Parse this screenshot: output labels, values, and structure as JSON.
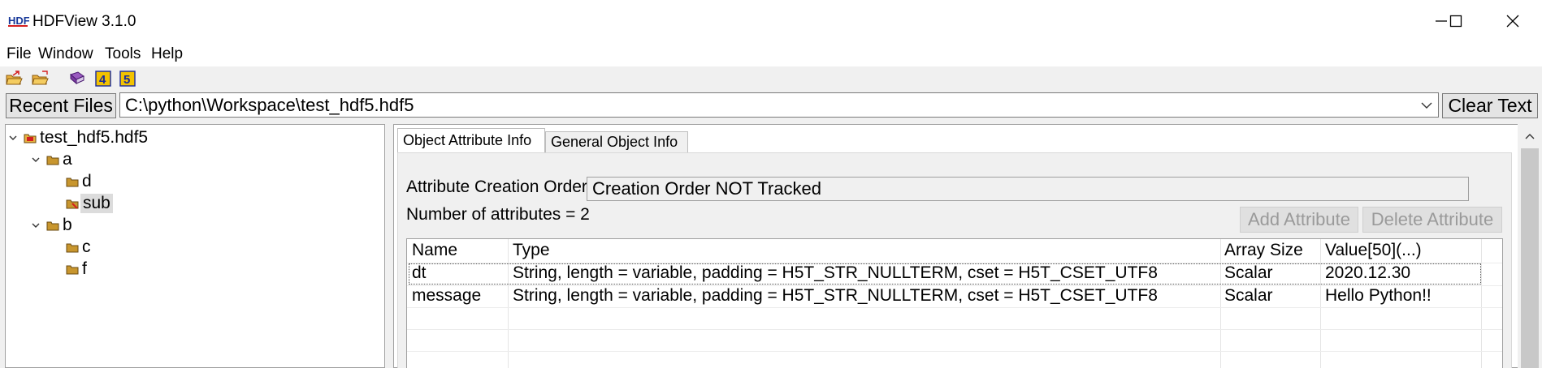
{
  "window": {
    "title": "HDFView 3.1.0",
    "logo_text": "HDF"
  },
  "menu": {
    "items": [
      {
        "label": "File"
      },
      {
        "label": "Window"
      },
      {
        "label": "Tools"
      },
      {
        "label": "Help"
      }
    ]
  },
  "toolbar": {
    "icons": [
      "open-folder-icon",
      "open-read-only-folder-icon",
      "user-guide-book-icon",
      "hdf4-library-icon",
      "hdf5-library-icon"
    ],
    "badge_4": "4",
    "badge_5": "5"
  },
  "path_bar": {
    "recent_files_label": "Recent Files",
    "current_path": "C:\\python\\Workspace\\test_hdf5.hdf5",
    "clear_text_label": "Clear Text"
  },
  "tree": {
    "root": {
      "label": "test_hdf5.hdf5",
      "expanded": true
    },
    "nodes": [
      {
        "label": "a",
        "expanded": true,
        "level": 1,
        "type": "group"
      },
      {
        "label": "d",
        "level": 2,
        "type": "group"
      },
      {
        "label": "sub",
        "level": 2,
        "type": "group",
        "selected": true
      },
      {
        "label": "b",
        "expanded": true,
        "level": 1,
        "type": "group"
      },
      {
        "label": "c",
        "level": 2,
        "type": "group"
      },
      {
        "label": "f",
        "level": 2,
        "type": "group"
      }
    ]
  },
  "tabs": [
    {
      "label": "Object Attribute Info",
      "active": true
    },
    {
      "label": "General Object Info",
      "active": false
    }
  ],
  "attribute_info": {
    "creation_order_label": "Attribute Creation Order:",
    "creation_order_value": "Creation Order NOT Tracked",
    "count_label": "Number of attributes = 2",
    "add_button": "Add Attribute",
    "delete_button": "Delete Attribute"
  },
  "attribute_table": {
    "headers": [
      "Name",
      "Type",
      "Array Size",
      "Value[50](...)"
    ],
    "rows": [
      [
        "dt",
        "String, length = variable, padding = H5T_STR_NULLTERM, cset = H5T_CSET_UTF8",
        "Scalar",
        "2020.12.30"
      ],
      [
        "message",
        "String, length = variable, padding = H5T_STR_NULLTERM, cset = H5T_CSET_UTF8",
        "Scalar",
        "Hello Python!!"
      ]
    ]
  },
  "colors": {
    "folder": "#c8962e",
    "selected_node_mark": "#d42020",
    "book": "#7a3aa0",
    "badge_bg": "#f2c200",
    "badge_text": "#1a2a9a"
  }
}
